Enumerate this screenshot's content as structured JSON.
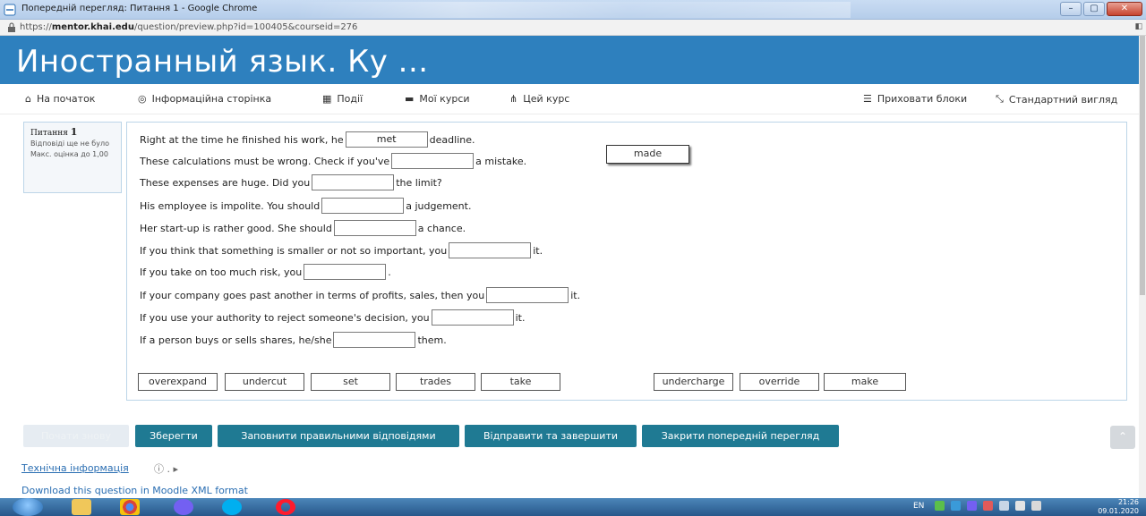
{
  "browser": {
    "window_title": "Попередній перегляд: Питання 1 - Google Chrome",
    "url_prefix": "https://",
    "url_host": "mentor.khai.edu",
    "url_path": "/question/preview.php?id=100405&courseid=276",
    "minimize": "–",
    "maximize": "▢",
    "close": "✕"
  },
  "site": {
    "title": "Иностранный язык. Ку ..."
  },
  "nav": {
    "home": "На початок",
    "info_page": "Інформаційна сторінка",
    "events": "Події",
    "my_courses": "Мої курси",
    "this_course": "Цей курс",
    "hide_blocks": "Приховати блоки",
    "standard_view": "Стандартний вигляд"
  },
  "info": {
    "question_label": "Питання",
    "question_number": "1",
    "status": "Відповіді ще не було",
    "max_grade": "Макс. оцінка до 1,00"
  },
  "question": {
    "lines": [
      {
        "before": "Right at the time he finished his work, he",
        "value": "met",
        "after": "deadline."
      },
      {
        "before": "These calculations must be wrong. Check if you've",
        "value": "",
        "after": "a mistake."
      },
      {
        "before": "These expenses are huge. Did you",
        "value": "",
        "after": "the limit?"
      },
      {
        "before": "His employee is impolite. You should",
        "value": "",
        "after": "a judgement."
      },
      {
        "before": "Her start-up is rather good. She should",
        "value": "",
        "after": "a chance."
      },
      {
        "before": "If you think that something is smaller or not so important, you",
        "value": "",
        "after": "it."
      },
      {
        "before": "If you take on too much risk, you",
        "value": "",
        "after": "."
      },
      {
        "before": "If your company goes past another in terms of profits, sales, then you",
        "value": "",
        "after": "it."
      },
      {
        "before": "If you use your authority to reject someone's decision, you",
        "value": "",
        "after": "it."
      },
      {
        "before": "If a person buys or sells shares, he/she",
        "value": "",
        "after": "them."
      }
    ],
    "dragging_item": "made",
    "choices": [
      "overexpand",
      "undercut",
      "set",
      "trades",
      "take",
      "undercharge",
      "override",
      "make"
    ]
  },
  "buttons": {
    "start_again": "Почати знову",
    "save": "Зберегти",
    "fill_correct": "Заповнити правильними відповідями",
    "submit_finish": "Відправити та завершити",
    "close_preview": "Закрити попередній перегляд"
  },
  "footer": {
    "tech_info": "Технічна інформація",
    "download": "Download this question in Moodle XML format"
  },
  "taskbar": {
    "lang": "EN",
    "time": "21:26",
    "date": "09.01.2020"
  },
  "colors": {
    "header": "#2e80be",
    "button": "#1f7a93",
    "link": "#2a6eb2"
  }
}
